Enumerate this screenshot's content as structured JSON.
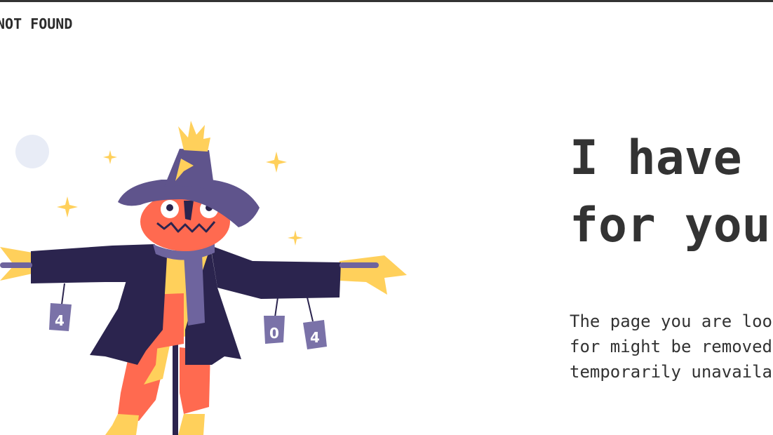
{
  "header": {
    "brand": "NOT FOUND"
  },
  "main": {
    "headline_lines": [
      "I have b",
      "for you"
    ],
    "description_lines": [
      "The page you are loo",
      "for might be removed",
      "temporarily unavaila"
    ]
  },
  "illustration": {
    "subject": "scarecrow",
    "can_labels": [
      "4",
      "0",
      "4"
    ],
    "colors": {
      "hat": "#5f548c",
      "coat": "#2b244e",
      "face": "#ff6a50",
      "straw": "#ffd05b",
      "moon": "#e8ecf6",
      "scarf": "#6e649e"
    }
  }
}
